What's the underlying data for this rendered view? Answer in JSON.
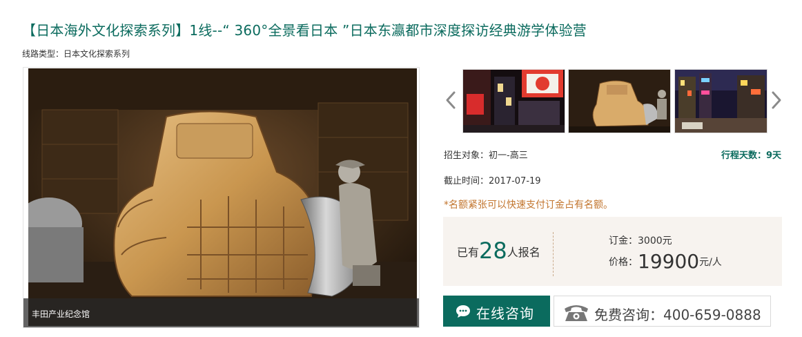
{
  "header": {
    "title": "【日本海外文化探索系列】1线--“ 360°全景看日本 ”日本东瀛都市深度探访经典游学体验营",
    "route_type": "线路类型：日本文化探索系列"
  },
  "gallery": {
    "main_caption": "丰田产业纪念馆",
    "thumbnails": [
      "night-city-street",
      "car-model-exhibit",
      "neon-street-night"
    ],
    "prev_icon": "chevron-left-icon",
    "next_icon": "chevron-right-icon"
  },
  "info": {
    "target": "招生对象：初一-高三",
    "days": "行程天数：9天",
    "deadline": "截止时间：2017-07-19",
    "notice": "*名额紧张可以快速支付订金占有名额。"
  },
  "pricing": {
    "enrolled_prefix": "已有",
    "enrolled_count": "28",
    "enrolled_suffix": "人报名",
    "deposit": "订金：3000元",
    "price_label": "价格：",
    "price_amount": "19900",
    "price_unit": "元/人"
  },
  "actions": {
    "consult_label": "在线咨询",
    "phone_label": "免费咨询：400-659-0888"
  },
  "colors": {
    "brand": "#0b6b5e",
    "notice": "#c2752e",
    "price_box_bg": "#f7f3ef"
  }
}
